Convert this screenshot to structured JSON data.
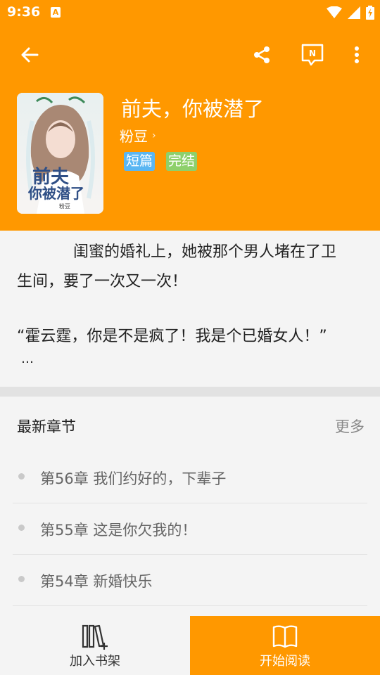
{
  "status_bar": {
    "time": "9:36",
    "notification_icon": "A"
  },
  "toolbar": {
    "back_icon": "arrow-left-icon",
    "share_icon": "share-icon",
    "n_icon": "N",
    "more_icon": "more-vertical-icon"
  },
  "book": {
    "title": "前夫，你被潜了",
    "author": "粉豆",
    "author_chevron": "›",
    "tags": [
      "短篇",
      "完结"
    ],
    "cover": {
      "title_line1": "前夫",
      "title_line2": "你被潜了",
      "author": "粉豆"
    }
  },
  "synopsis": {
    "line1": "闺蜜的婚礼上，她被那个男人堵在了卫",
    "line2": "生间，要了一次又一次！",
    "line3": "“霍云霆，你是不是疯了！我是个已婚女人！”",
    "line4": "…"
  },
  "chapters": {
    "title": "最新章节",
    "more": "更多",
    "items": [
      {
        "label": "第56章 我们约好的，下辈子"
      },
      {
        "label": "第55章 这是你欠我的！"
      },
      {
        "label": "第54章 新婚快乐"
      }
    ]
  },
  "bottom": {
    "add_shelf_label": "加入书架",
    "start_read_label": "开始阅读"
  },
  "colors": {
    "accent": "#ff9800",
    "tag_blue": "#5ab6f2",
    "tag_green": "#8ed06c"
  }
}
